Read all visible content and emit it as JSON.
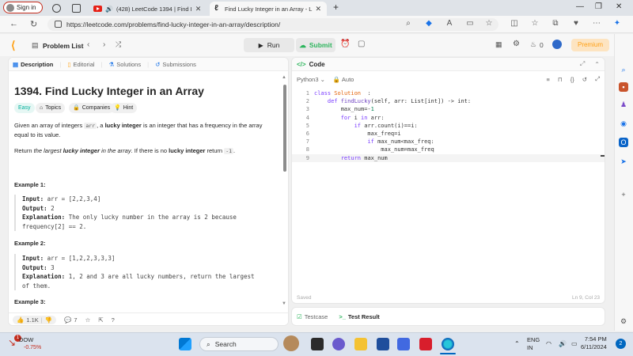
{
  "browser": {
    "signin_label": "Sign in",
    "tabs": [
      {
        "label": "(428) LeetCode 1394 | Find I",
        "type": "youtube"
      },
      {
        "label": "Find Lucky Integer in an Array - L",
        "type": "leetcode"
      }
    ],
    "url": "https://leetcode.com/problems/find-lucky-integer-in-an-array/description/"
  },
  "lc_nav": {
    "problem_list": "Problem List",
    "run": "Run",
    "submit": "Submit",
    "fire_count": "0",
    "premium": "Premium"
  },
  "left_tabs": [
    "Description",
    "Editorial",
    "Solutions",
    "Submissions"
  ],
  "problem": {
    "title": "1394. Find Lucky Integer in an Array",
    "difficulty": "Easy",
    "chips": [
      "Topics",
      "Companies",
      "Hint"
    ],
    "desc1_pre": "Given an array of integers ",
    "desc1_code": "arr",
    "desc1_mid": ", a ",
    "desc1_bold": "lucky integer",
    "desc1_post": " is an integer that has a frequency in the array equal to its value.",
    "desc2_pre": "Return ",
    "desc2_italic": "the largest ",
    "desc2_bolditalic": "lucky integer",
    "desc2_italic2": " in the array",
    "desc2_mid": ". If there is no ",
    "desc2_bold": "lucky integer",
    "desc2_post": " return ",
    "desc2_code": "-1",
    "desc2_end": ".",
    "examples": [
      {
        "heading": "Example 1:",
        "input_label": "Input:",
        "input": "arr = [2,2,3,4]",
        "output_label": "Output:",
        "output": "2",
        "expl_label": "Explanation:",
        "expl": "The only lucky number in the array is 2 because",
        "expl2": "frequency[2] == 2."
      },
      {
        "heading": "Example 2:",
        "input_label": "Input:",
        "input": "arr = [1,2,2,3,3,3]",
        "output_label": "Output:",
        "output": "3",
        "expl_label": "Explanation:",
        "expl": "1, 2 and 3 are all lucky numbers, return the largest",
        "expl2": "of them."
      }
    ],
    "example3_heading": "Example 3:"
  },
  "left_footer": {
    "likes": "1.1K",
    "comments": "7"
  },
  "code_panel": {
    "title": "Code",
    "language": "Python3",
    "auto": "Auto",
    "saved": "Saved",
    "cursor": "Ln 9, Col 23"
  },
  "code_lines": [
    {
      "n": "1",
      "parts": [
        [
          "kw",
          "class "
        ],
        [
          "cls",
          "Solution"
        ],
        [
          "",
          "  :"
        ]
      ]
    },
    {
      "n": "2",
      "parts": [
        [
          "",
          "    "
        ],
        [
          "kw",
          "def "
        ],
        [
          "fn",
          "findLucky"
        ],
        [
          "",
          "(self, arr: List[int]) -> int:"
        ]
      ]
    },
    {
      "n": "3",
      "parts": [
        [
          "",
          "        max_num=-"
        ],
        [
          "num",
          "1"
        ]
      ]
    },
    {
      "n": "4",
      "parts": [
        [
          "",
          "        "
        ],
        [
          "kw",
          "for "
        ],
        [
          "",
          "i "
        ],
        [
          "kw",
          "in "
        ],
        [
          "",
          "arr:"
        ]
      ]
    },
    {
      "n": "5",
      "parts": [
        [
          "",
          "            "
        ],
        [
          "kw",
          "if "
        ],
        [
          "",
          "arr.count(i)==i:"
        ]
      ]
    },
    {
      "n": "6",
      "parts": [
        [
          "",
          "                max_freq=i"
        ]
      ]
    },
    {
      "n": "7",
      "parts": [
        [
          "",
          "                "
        ],
        [
          "kw",
          "if "
        ],
        [
          "",
          "max_num<max_freq:"
        ]
      ]
    },
    {
      "n": "8",
      "parts": [
        [
          "",
          "                    max_num=max_freq"
        ]
      ]
    },
    {
      "n": "9",
      "parts": [
        [
          "",
          "        "
        ],
        [
          "kw",
          "return "
        ],
        [
          "",
          "max_num"
        ]
      ]
    }
  ],
  "bottom_tabs": {
    "testcase": "Testcase",
    "test_result": "Test Result"
  },
  "taskbar": {
    "ticker": "DOW",
    "ticker_change": "-0.75%",
    "ticker_badge": "1",
    "search_placeholder": "Search",
    "lang_line1": "ENG",
    "lang_line2": "IN",
    "time": "7:54 PM",
    "date": "6/11/2024",
    "notif_count": "2"
  },
  "colors": {
    "accent": "#ffa116",
    "submit_green": "#2db55d",
    "easy": "#00af9b"
  }
}
